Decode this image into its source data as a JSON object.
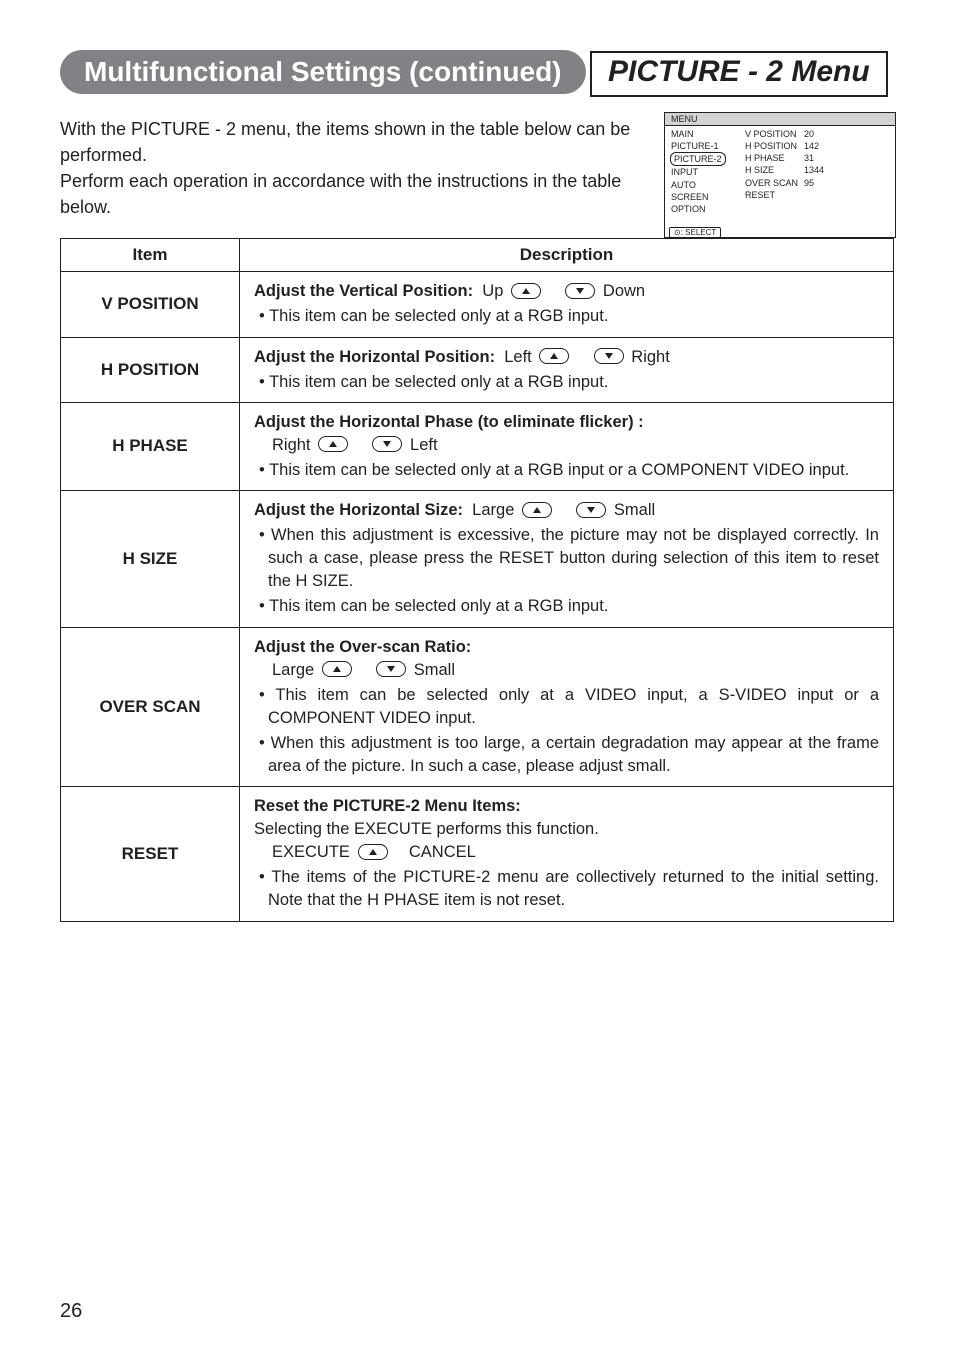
{
  "header": "Multifunctional Settings (continued)",
  "section_title": "PICTURE - 2 Menu",
  "intro_line1": "With the PICTURE - 2 menu, the items shown in the table below can be performed.",
  "intro_line2": "Perform each operation in accordance with the instructions in the table below.",
  "menu_preview": {
    "title": "MENU",
    "left": [
      "MAIN",
      "PICTURE-1",
      "PICTURE-2",
      "INPUT",
      "AUTO",
      "SCREEN",
      "OPTION"
    ],
    "selected_index": 2,
    "right": [
      {
        "label": "V POSITION",
        "value": "20"
      },
      {
        "label": "H POSITION",
        "value": "142"
      },
      {
        "label": "H PHASE",
        "value": "31"
      },
      {
        "label": "H SIZE",
        "value": "1344"
      },
      {
        "label": "OVER SCAN",
        "value": "95"
      },
      {
        "label": "RESET",
        "value": ""
      }
    ],
    "footer": ": SELECT"
  },
  "table": {
    "headers": {
      "item": "Item",
      "desc": "Description"
    },
    "rows": [
      {
        "item": "V POSITION",
        "lead": "Adjust the Vertical Position:",
        "a": "Up",
        "b": "Down",
        "notes": [
          "• This item can be selected only at a RGB input."
        ]
      },
      {
        "item": "H POSITION",
        "lead": "Adjust the Horizontal Position:",
        "a": "Left",
        "b": "Right",
        "notes": [
          "• This item can be selected only at a RGB input."
        ]
      },
      {
        "item": "H PHASE",
        "lead": "Adjust the Horizontal Phase (to eliminate flicker) :",
        "a": "Right",
        "b": "Left",
        "ab_newline": true,
        "notes": [
          "• This item can be selected only at a RGB input or a COMPONENT VIDEO input."
        ]
      },
      {
        "item": "H SIZE",
        "lead": "Adjust the Horizontal Size:",
        "a": "Large",
        "b": "Small",
        "notes": [
          "• When this adjustment is excessive, the picture may not be displayed correctly. In such a case, please press the RESET button during selection of this item to reset the H SIZE.",
          "• This item can be selected only at a RGB input."
        ]
      },
      {
        "item": "OVER SCAN",
        "lead": "Adjust the Over-scan Ratio:",
        "a": "Large",
        "b": "Small",
        "ab_newline": true,
        "notes": [
          "• This item can be selected only at a VIDEO input, a S-VIDEO input or a COMPONENT VIDEO input.",
          "• When this adjustment is too large, a certain degradation may appear at the frame area of the picture. In such a case, please adjust small."
        ]
      },
      {
        "item": "RESET",
        "lead": "Reset the PICTURE-2 Menu Items:",
        "extra": "Selecting the EXECUTE performs this function.",
        "exec_a": "EXECUTE",
        "exec_b": "CANCEL",
        "notes": [
          "• The items of the PICTURE-2 menu are collectively returned to the initial setting. Note that the H PHASE item is not reset."
        ]
      }
    ]
  },
  "page_number": "26"
}
